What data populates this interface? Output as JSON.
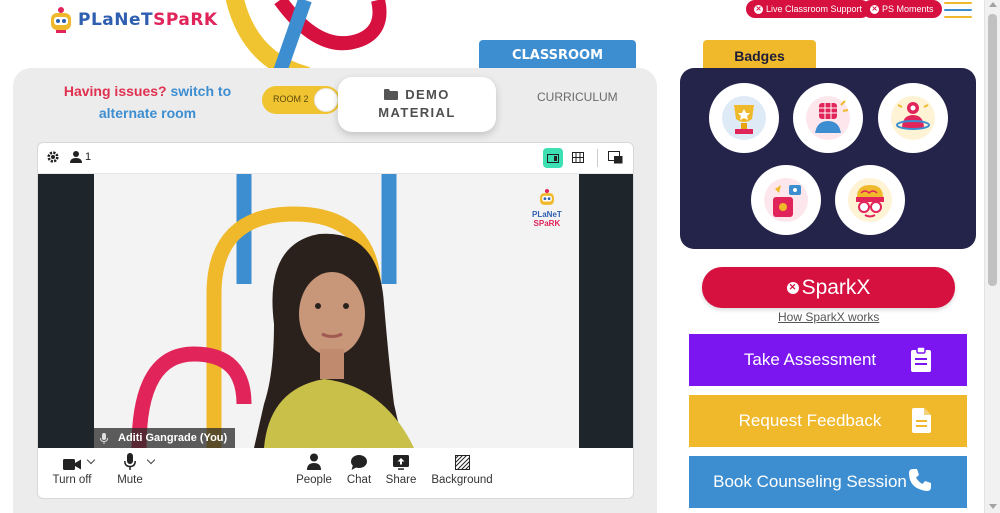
{
  "header": {
    "logo_text_1": "PLaNeT",
    "logo_text_2": "SPaRK",
    "live_support": "Live Classroom Support",
    "ps_moments": "PS Moments"
  },
  "classroom": {
    "tab_label": "CLASSROOM",
    "issues_prefix": "Having issues?",
    "issues_link": "switch to alternate room",
    "room_toggle": "ROOM 2",
    "demo_line1": "DEMO",
    "demo_line2": "MATERIAL",
    "curriculum": "CURRICULUM"
  },
  "video": {
    "participant_count": "1",
    "participant_name": "Aditi Gangrade (You)",
    "overlay_logo_1": "PLaNeT",
    "overlay_logo_2": "SPaRK",
    "controls": {
      "turn_off": "Turn off",
      "mute": "Mute",
      "people": "People",
      "chat": "Chat",
      "share": "Share",
      "background": "Background"
    }
  },
  "badges": {
    "tab_label": "Badges",
    "icons": [
      "trophy-badge-icon",
      "fist-badge-icon",
      "meditation-badge-icon",
      "robot-badge-icon",
      "brain-badge-icon"
    ]
  },
  "right_panel": {
    "sparkx": "SparkX",
    "sparkx_link": "How SparkX works",
    "take_assessment": "Take Assessment",
    "request_feedback": "Request Feedback",
    "book_counseling": "Book Counseling Session"
  },
  "colors": {
    "brand_red": "#d6103f",
    "brand_blue": "#3d8ed1",
    "brand_yellow": "#f0b82b",
    "purple": "#7b16f0",
    "badge_bg": "#24234a"
  }
}
